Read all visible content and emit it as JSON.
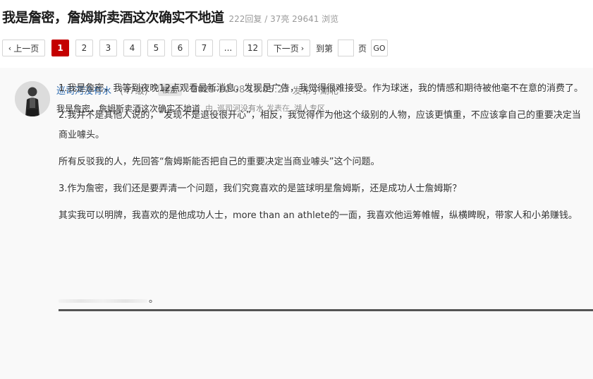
{
  "header": {
    "title": "我是詹密，詹姆斯卖酒这次确实不地道",
    "stats": "222回复 / 37亮 29641 浏览"
  },
  "pagination": {
    "prev": "上一页",
    "pages": [
      "1",
      "2",
      "3",
      "4",
      "5",
      "6",
      "7",
      "...",
      "12"
    ],
    "current": "1",
    "next": "下一页",
    "goto_prefix": "到第",
    "goto_suffix": "页",
    "go": "GO"
  },
  "post": {
    "author": "巡司河没有水",
    "level": "(47级)",
    "badge": "楼主",
    "time": "2025-10-08 13:05:27",
    "location": "发布于湖北",
    "subtitle": "我是詹密，詹姆斯卖酒这次确实不地道",
    "by": "由",
    "sub_author": "巡司河没有水",
    "posted_in": "发表在",
    "zone": "湖人专区",
    "paragraphs": [
      "1.我是詹密，我等到夜晚12点观看最新消息，发现是广告，我觉得很难接受。作为球迷，我的情感和期待被他毫不在意的消费了。",
      "2.我并不是其他人说的，“发现不是退役很开心”，相反，我觉得作为他这个级别的人物，应该更慎重，不应该拿自己的重要决定当商业噱头。",
      "所有反驳我的人，先回答“詹姆斯能否把自己的重要决定当商业噱头”这个问题。",
      "3.作为詹密，我们还是要弄清一个问题，我们究竟喜欢的是篮球明星詹姆斯，还是成功人士詹姆斯？",
      "其实我可以明牌，我喜欢的是他成功人士，more than an athlete的一面，我喜欢他运筹帷幄，纵横睥睨，带家人和小弟赚钱。"
    ],
    "trailing": "。"
  },
  "colors": {
    "accent": "#c40000",
    "link": "#2f6db2"
  }
}
